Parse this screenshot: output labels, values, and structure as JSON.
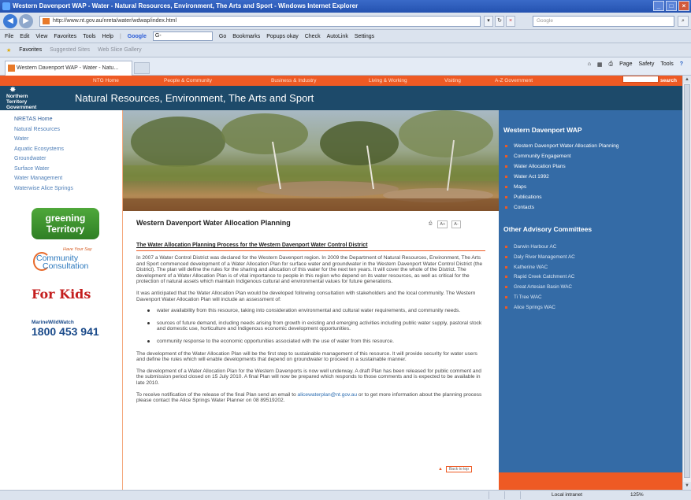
{
  "window": {
    "title": "Western Davenport WAP - Water - Natural Resources, Environment, The Arts and Sport - Windows Internet Explorer"
  },
  "browser": {
    "url": "http://www.nt.gov.au/nreta/water/wdwap/index.html",
    "search_placeholder": "Google",
    "menu": [
      "File",
      "Edit",
      "View",
      "Favorites",
      "Tools",
      "Help"
    ],
    "google_toolbar": "Google",
    "google_input": "G-",
    "toolbar_items": [
      "Go",
      "Bookmarks",
      "Popups okay",
      "Check",
      "AutoLink",
      "Settings"
    ],
    "favorites_label": "Favorites",
    "suggested_sites": "Suggested Sites",
    "web_slice": "Web Slice Gallery",
    "tab_title": "Western Davenport WAP - Water - Natu...",
    "command_bar": [
      "Page",
      "Safety",
      "Tools"
    ],
    "status": {
      "zone": "Local intranet",
      "zoom": "125%"
    }
  },
  "site": {
    "top_nav": [
      "NTG Home",
      "People & Community",
      "Business & Industry",
      "Living & Working",
      "Visiting",
      "A-Z Government"
    ],
    "search_button": "search",
    "logo_lines": [
      "Northern",
      "Territory",
      "Government"
    ],
    "header_title": "Natural Resources, Environment, The Arts and Sport",
    "left_nav": [
      "NRETAS Home",
      "Natural Resources",
      "Water",
      "Aquatic Ecosystems",
      "Groundwater",
      "Surface Water",
      "Water Management",
      "Waterwise Alice Springs"
    ],
    "promos": {
      "greening": [
        "greening",
        "Territory"
      ],
      "community_sub": "Have Your Say",
      "community_main": [
        "Community",
        "Consultation"
      ],
      "forkids": "For Kids",
      "marine_a": "MarineWildWatch",
      "marine_b": "1800 453 941"
    },
    "content": {
      "title": "Western Davenport Water Allocation Planning",
      "tools": [
        "A+",
        "A-"
      ],
      "subhead": "The Water Allocation Planning Process for the Western Davenport Water Control District",
      "p1": "In 2007 a Water Control District was declared for the Western Davenport region. In 2009 the Department of Natural Resources, Environment, The Arts and Sport commenced development of a Water Allocation Plan for surface water and groundwater in the Western Davenport Water Control District (the District). The plan will define the rules for the sharing and allocation of this water for the next ten years. It will cover the whole of the District. The development of a Water Allocation Plan is of vital importance to people in this region who depend on its water resources, as well as critical for the protection of natural assets which maintain Indigenous cultural and environmental values for future generations.",
      "p2": "It was anticipated that the Water Allocation Plan would be developed following consultation with stakeholders and the local community. The Western Davenport Water Allocation Plan will include an assessment of:",
      "bullets": [
        "water availability from this resource, taking into consideration environmental and cultural water requirements, and community needs.",
        "sources of future demand, including needs arising from growth in existing and emerging activities including public water supply, pastoral stock and domestic use, horticulture and Indigenous economic development opportunities.",
        "community response to the economic opportunities associated with the use of water from this resource."
      ],
      "p3": "The development of the Water Allocation Plan will be the first step to sustainable management of this resource. It will provide security for water users and define the rules which will enable developments that depend on groundwater to proceed in a sustainable manner.",
      "p4": "The development of a Water Allocation Plan for the Western Davenports is now well underway. A draft Plan has been released for public comment and the submission period closed on 15 July 2010. A final Plan will now be prepared which responds to those comments and is expected to be available in late 2010.",
      "p5_a": "To receive notification of the release of the final Plan send an email to ",
      "p5_link": "alicewaterplan@nt.gov.au",
      "p5_b": " or to get more information about the planning process please contact the Alice Springs Water Planner on 08 89519202.",
      "back_top": "Back to top"
    },
    "right": {
      "heading1": "Western Davenport WAP",
      "list1": [
        "Western Davenport Water Allocation Planning",
        "Community Engagement",
        "Water Allocation Plans",
        "Water Act 1992",
        "Maps",
        "Publications",
        "Contacts"
      ],
      "heading2": "Other Advisory Committees",
      "list2": [
        "Darwin Harbour AC",
        "Daly River Management AC",
        "Katherine WAC",
        "Rapid Creek Catchment AC",
        "Great Artesian Basin WAC",
        "Ti Tree WAC",
        "Alice Springs WAC"
      ]
    }
  }
}
